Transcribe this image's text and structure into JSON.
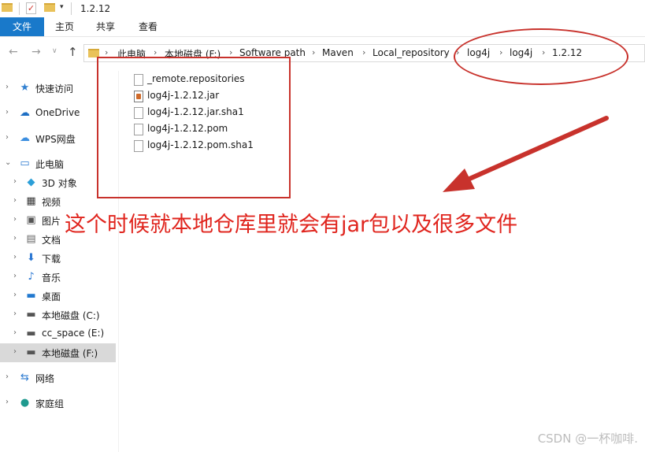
{
  "window": {
    "title": "1.2.12"
  },
  "ribbon": {
    "tabs": [
      "文件",
      "主页",
      "共享",
      "查看"
    ]
  },
  "address": {
    "crumbs": [
      "此电脑",
      "本地磁盘 (F:)",
      "Software path",
      "Maven",
      "Local_repository",
      "log4j",
      "log4j",
      "1.2.12"
    ]
  },
  "sidebar": {
    "items": [
      {
        "label": "快速访问",
        "icon": "star-icon"
      },
      {
        "label": "OneDrive",
        "icon": "cloud-icon"
      },
      {
        "label": "WPS网盘",
        "icon": "cloud-icon"
      },
      {
        "label": "此电脑",
        "icon": "computer-icon"
      },
      {
        "label": "3D 对象",
        "icon": "cube-icon"
      },
      {
        "label": "视频",
        "icon": "film-icon"
      },
      {
        "label": "图片",
        "icon": "picture-icon"
      },
      {
        "label": "文档",
        "icon": "document-icon"
      },
      {
        "label": "下载",
        "icon": "download-icon"
      },
      {
        "label": "音乐",
        "icon": "music-icon"
      },
      {
        "label": "桌面",
        "icon": "desktop-icon"
      },
      {
        "label": "本地磁盘 (C:)",
        "icon": "drive-icon"
      },
      {
        "label": "cc_space (E:)",
        "icon": "drive-icon"
      },
      {
        "label": "本地磁盘 (F:)",
        "icon": "drive-icon"
      },
      {
        "label": "网络",
        "icon": "network-icon"
      },
      {
        "label": "家庭组",
        "icon": "homegroup-icon"
      }
    ]
  },
  "files": [
    {
      "name": "_remote.repositories",
      "type": "file"
    },
    {
      "name": "log4j-1.2.12.jar",
      "type": "jar"
    },
    {
      "name": "log4j-1.2.12.jar.sha1",
      "type": "file"
    },
    {
      "name": "log4j-1.2.12.pom",
      "type": "file"
    },
    {
      "name": "log4j-1.2.12.pom.sha1",
      "type": "file"
    }
  ],
  "annotation": {
    "text": "这个时候就本地仓库里就会有jar包以及很多文件"
  },
  "watermark": "CSDN @一杯咖啡.",
  "colors": {
    "accent": "#1979ca",
    "annotation": "#c8322c",
    "selection": "#d9d9d9"
  }
}
